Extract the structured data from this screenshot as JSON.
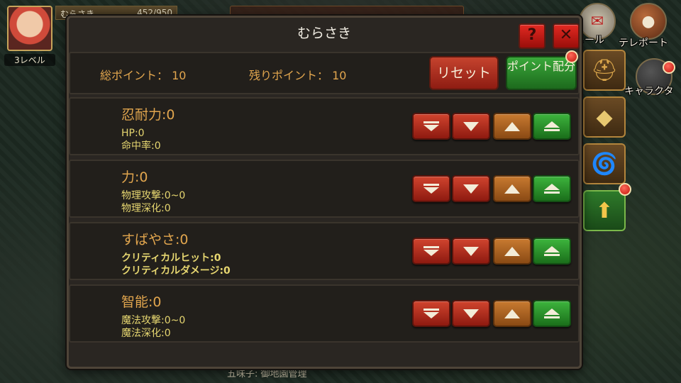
{
  "hud": {
    "player_name": "むらさき",
    "hp": "452/950",
    "level": "3レベル",
    "mail_label": "メール",
    "teleport_label": "テレポート",
    "character_label": "キャラクタ",
    "bottom_text": "五味子: 御地園管理"
  },
  "panel": {
    "title": "むらさき",
    "help_label": "?",
    "close_label": "✕"
  },
  "points": {
    "total_label": "総ポイント：",
    "total_value": "10",
    "remaining_label": "残りポイント：",
    "remaining_value": "10",
    "reset_label": "リセット",
    "allocate_label": "ポイント配分"
  },
  "stats": [
    {
      "name": "忍耐力:0",
      "sub1": "HP:0",
      "sub2": "命中率:0"
    },
    {
      "name": "力:0",
      "sub1": "物理攻撃:0~0",
      "sub2": "物理深化:0"
    },
    {
      "name": "すばやさ:0",
      "sub1": "クリティカルヒット:0",
      "sub2": "クリティカルダメージ:0"
    },
    {
      "name": "智能:0",
      "sub1": "魔法攻撃:0~0",
      "sub2": "魔法深化:0"
    }
  ],
  "side_tabs": [
    {
      "icon": "helmet-icon"
    },
    {
      "icon": "crystal-icon"
    },
    {
      "icon": "tornado-icon"
    },
    {
      "icon": "upgrade-arrow-icon",
      "active": true
    }
  ],
  "colors": {
    "label_orange": "#e2a64e",
    "sub_yellow": "#e6d670",
    "reset_red": "#b0301e",
    "allocate_green": "#2a8a2a"
  }
}
